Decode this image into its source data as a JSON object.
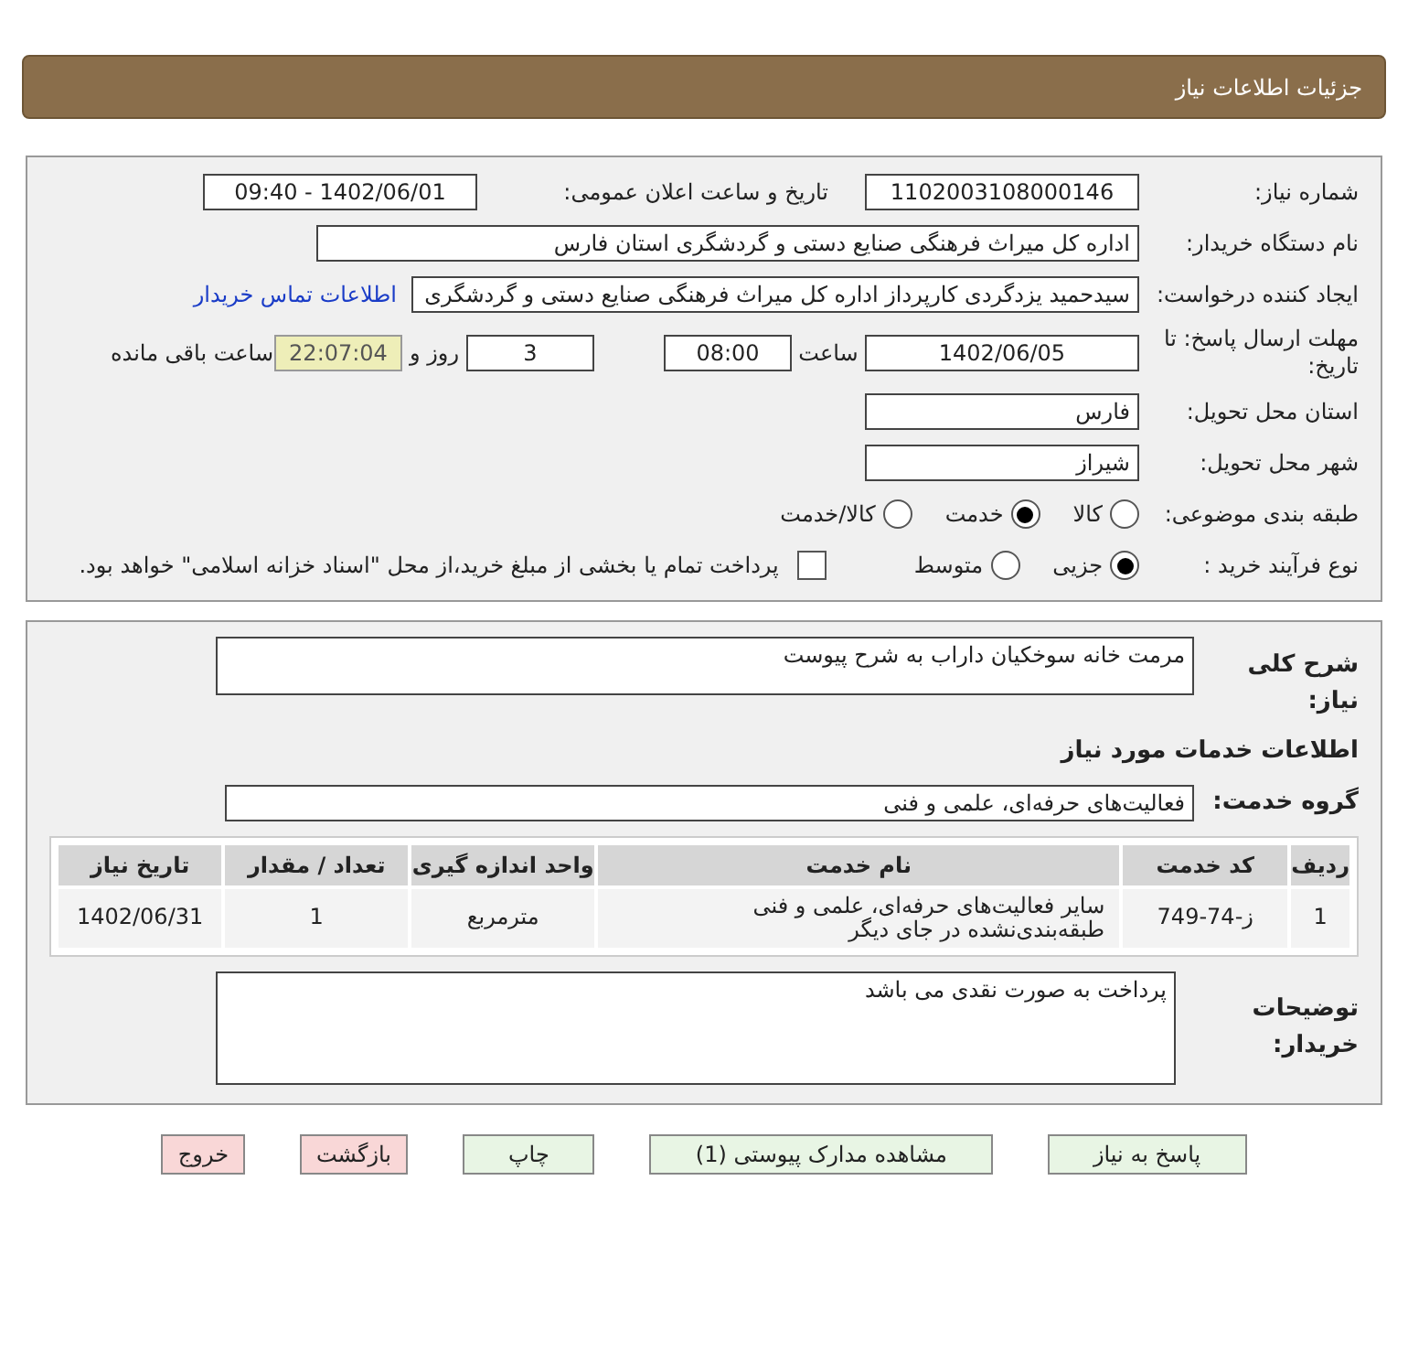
{
  "header": {
    "title": "جزئیات اطلاعات نیاز"
  },
  "need_number": {
    "label": "شماره نیاز:",
    "value": "1102003108000146"
  },
  "announce": {
    "label": "تاریخ و ساعت اعلان عمومی:",
    "value": "1402/06/01 - 09:40"
  },
  "buyer_org": {
    "label": "نام دستگاه خریدار:",
    "value": "اداره کل میراث فرهنگی  صنایع دستی و گردشگری استان فارس"
  },
  "requester": {
    "label": "ایجاد کننده درخواست:",
    "value": "سیدحمید یزدگردی کارپرداز اداره کل میراث فرهنگی  صنایع دستی و گردشگری",
    "link": "اطلاعات تماس خریدار"
  },
  "deadline": {
    "label": "مهلت ارسال پاسخ: تا تاریخ:",
    "date": "1402/06/05",
    "time_label": "ساعت",
    "time": "08:00",
    "days": "3",
    "days_label": "روز و",
    "remaining": "22:07:04",
    "remaining_label": "ساعت باقی مانده"
  },
  "province": {
    "label": "استان محل تحویل:",
    "value": "فارس"
  },
  "city": {
    "label": "شهر محل تحویل:",
    "value": "شیراز"
  },
  "category": {
    "label": "طبقه بندی موضوعی:",
    "options": [
      {
        "label": "کالا",
        "selected": false
      },
      {
        "label": "خدمت",
        "selected": true
      },
      {
        "label": "کالا/خدمت",
        "selected": false
      }
    ]
  },
  "purchase_type": {
    "label": "نوع فرآیند خرید :",
    "options": [
      {
        "label": "جزیی",
        "selected": true
      },
      {
        "label": "متوسط",
        "selected": false
      }
    ],
    "treasury": {
      "checked": false,
      "text": "پرداخت تمام یا بخشی از مبلغ خرید،از محل \"اسناد خزانه اسلامی\" خواهد بود."
    }
  },
  "description": {
    "label": "شرح کلی نیاز:",
    "value": "مرمت خانه سوخکیان داراب به شرح پیوست"
  },
  "services_title": "اطلاعات خدمات مورد نیاز",
  "service_group": {
    "label": "گروه خدمت:",
    "value": "فعالیت‌های حرفه‌ای، علمی و فنی"
  },
  "table": {
    "columns": [
      "ردیف",
      "کد خدمت",
      "نام خدمت",
      "واحد اندازه گیری",
      "تعداد / مقدار",
      "تاریخ نیاز"
    ],
    "rows": [
      [
        "1",
        "ز-74-749",
        "سایر فعالیت‌های حرفه‌ای، علمی و فنی طبقه‌بندی‌نشده در جای دیگر",
        "مترمربع",
        "1",
        "1402/06/31"
      ]
    ]
  },
  "buyer_notes": {
    "label": "توضیحات خریدار:",
    "value": "پرداخت به صورت نقدی می باشد"
  },
  "buttons": [
    {
      "label": "پاسخ به نیاز",
      "kind": "action"
    },
    {
      "label": "مشاهده مدارک پیوستی (1)",
      "kind": "action"
    },
    {
      "label": "چاپ",
      "kind": "action"
    },
    {
      "label": "بازگشت",
      "kind": "exit"
    },
    {
      "label": "خروج",
      "kind": "exit"
    }
  ]
}
